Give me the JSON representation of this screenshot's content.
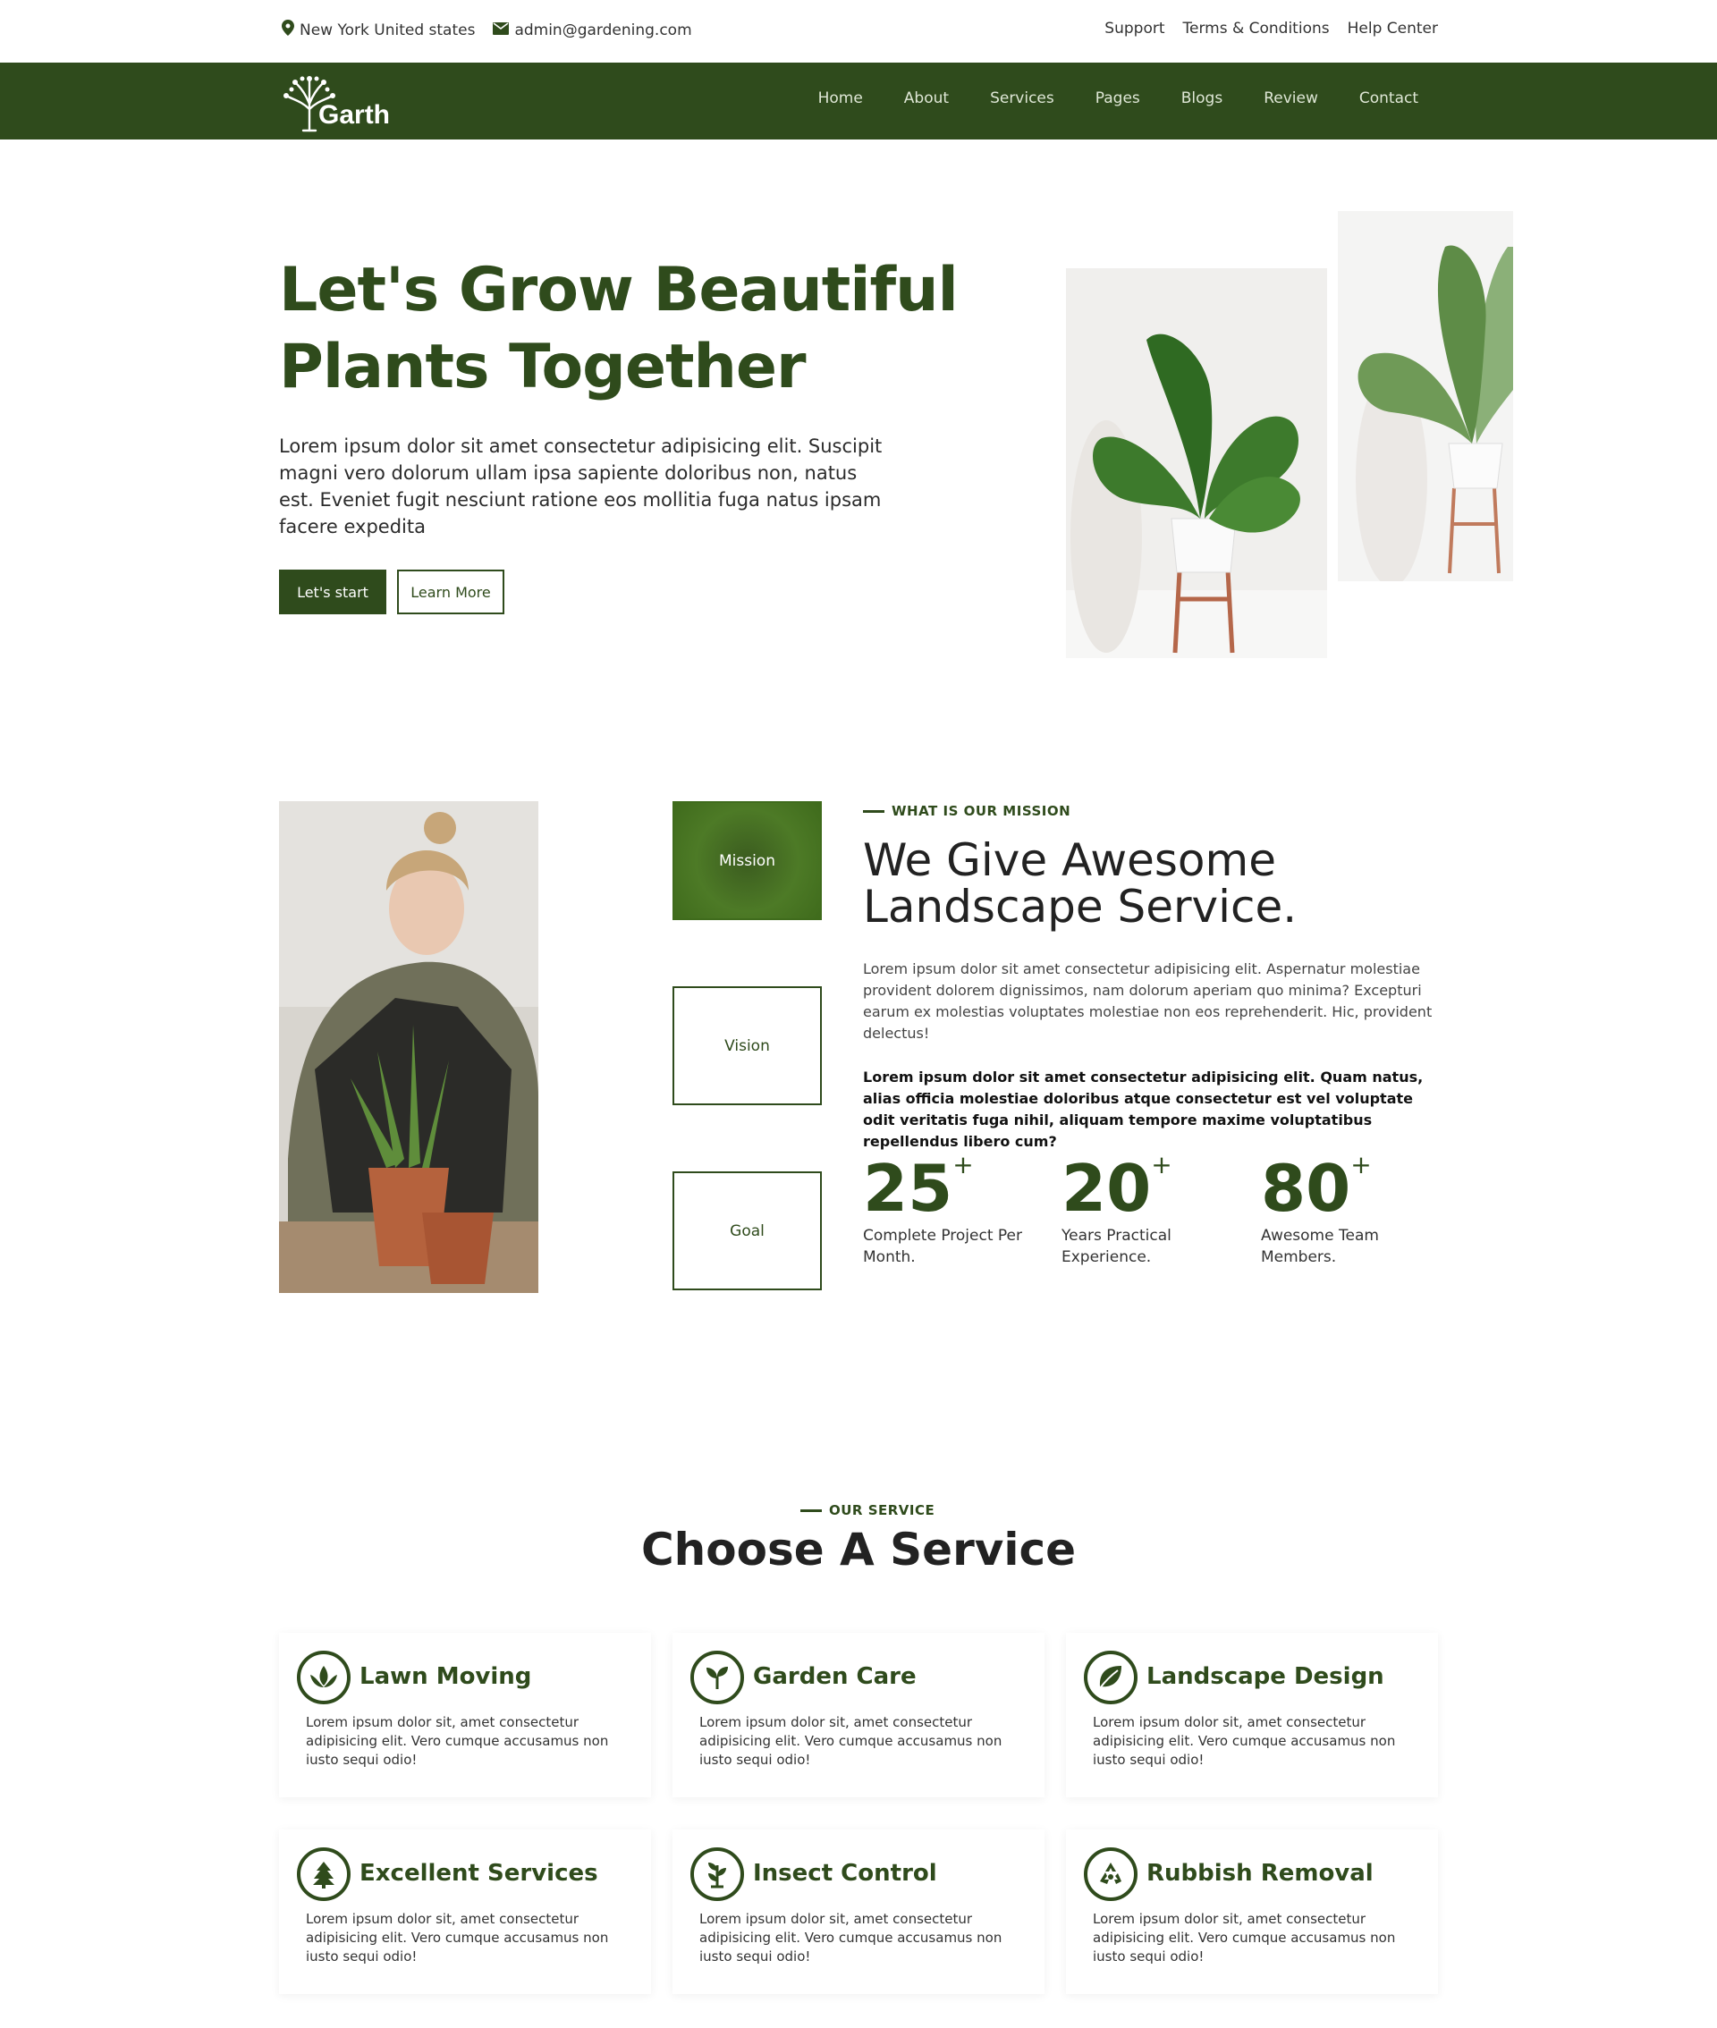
{
  "topbar": {
    "location": "New York United states",
    "email": "admin@gardening.com",
    "links": [
      "Support",
      "Terms & Conditions",
      "Help Center"
    ]
  },
  "nav": {
    "logo_text": "Garth",
    "items": [
      "Home",
      "About",
      "Services",
      "Pages",
      "Blogs",
      "Review",
      "Contact"
    ]
  },
  "hero": {
    "title_line1": "Let's Grow Beautiful",
    "title_line2": "Plants Together",
    "text": "Lorem ipsum dolor sit amet consectetur adipisicing elit. Suscipit magni vero dolorum ullam ipsa sapiente doloribus non, natus est. Eveniet fugit nesciunt ratione eos mollitia fuga natus ipsam facere expedita",
    "start_label": "Let's start",
    "learn_label": "Learn More"
  },
  "mission": {
    "tabs": [
      "Mission",
      "Vision",
      "Goal"
    ],
    "kicker": "WHAT IS OUR MISSION",
    "title_line1": "We Give Awesome",
    "title_line2": "Landscape Service.",
    "paragraph": "Lorem ipsum dolor sit amet consectetur adipisicing elit. Aspernatur molestiae provident dolorem dignissimos, nam dolorum aperiam quo minima? Excepturi earum ex molestias voluptates molestiae non eos reprehenderit. Hic, provident delectus!",
    "bold_paragraph": "Lorem ipsum dolor sit amet consectetur adipisicing elit. Quam natus, alias officia molestiae doloribus atque consectetur est vel voluptate odit veritatis fuga nihil, aliquam tempore maxime voluptatibus repellendus libero cum?",
    "stats": [
      {
        "value": "25",
        "plus": "+",
        "label": "Complete Project Per Month."
      },
      {
        "value": "20",
        "plus": "+",
        "label": "Years Practical Experience."
      },
      {
        "value": "80",
        "plus": "+",
        "label": "Awesome Team Members."
      }
    ]
  },
  "services": {
    "kicker": "OUR SERVICE",
    "title": "Choose A Service",
    "cards": [
      {
        "icon": "lotus-icon",
        "title": "Lawn Moving",
        "text": "Lorem ipsum dolor sit, amet consectetur adipisicing elit. Vero cumque accusamus non iusto sequi odio!"
      },
      {
        "icon": "sprout-icon",
        "title": "Garden Care",
        "text": "Lorem ipsum dolor sit, amet consectetur adipisicing elit. Vero cumque accusamus non iusto sequi odio!"
      },
      {
        "icon": "leaf-icon",
        "title": "Landscape Design",
        "text": "Lorem ipsum dolor sit, amet consectetur adipisicing elit. Vero cumque accusamus non iusto sequi odio!"
      },
      {
        "icon": "tree-icon",
        "title": "Excellent Services",
        "text": "Lorem ipsum dolor sit, amet consectetur adipisicing elit. Vero cumque accusamus non iusto sequi odio!"
      },
      {
        "icon": "plant-icon",
        "title": "Insect Control",
        "text": "Lorem ipsum dolor sit, amet consectetur adipisicing elit. Vero cumque accusamus non iusto sequi odio!"
      },
      {
        "icon": "recycle-icon",
        "title": "Rubbish Removal",
        "text": "Lorem ipsum dolor sit, amet consectetur adipisicing elit. Vero cumque accusamus non iusto sequi odio!"
      }
    ]
  },
  "colors": {
    "brand": "#2f4b1c",
    "accent": "#4d7a26"
  }
}
